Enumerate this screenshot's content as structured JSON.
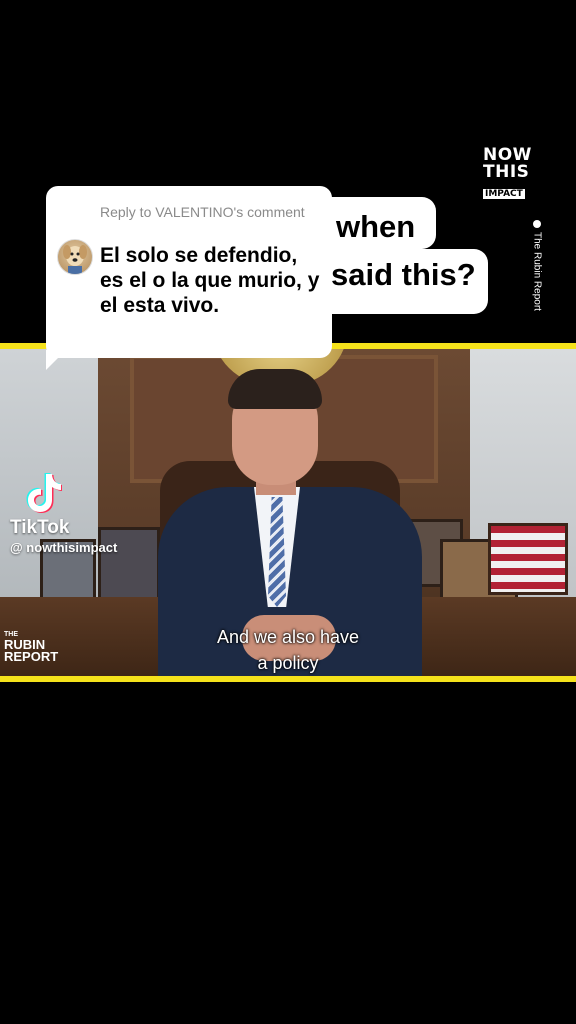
{
  "brand": {
    "line1": "NOW",
    "line2": "THIS",
    "line3": "IMPACT"
  },
  "credit": "The Rubin Report",
  "question": {
    "line1": "when",
    "line2": "said this?"
  },
  "reply": {
    "header": "Reply to VALENTINO's comment",
    "body": "El solo se defendio, es el o la que murio, y el esta vivo."
  },
  "video": {
    "watermark_top": "THE",
    "watermark_line1": "RUBIN",
    "watermark_line2": "REPORT",
    "subtitle_line1": "And we also have",
    "subtitle_line2": "a policy"
  },
  "tiktok": {
    "name": "TikTok",
    "username": "@ nowthisimpact"
  },
  "colors": {
    "frame_yellow": "#f5e21b",
    "background": "#000000"
  }
}
